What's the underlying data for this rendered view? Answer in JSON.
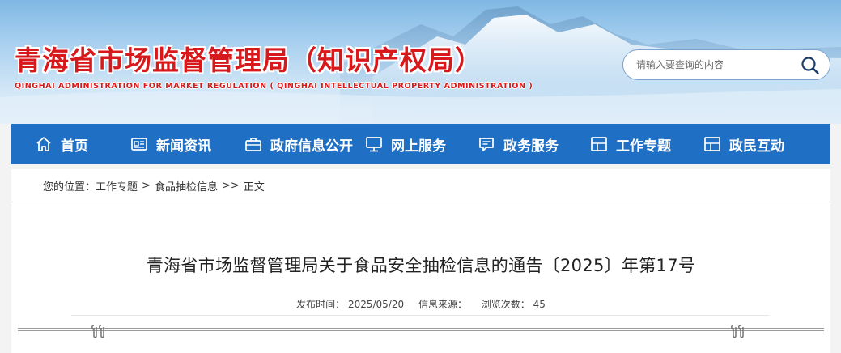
{
  "header": {
    "title": "青海省市场监督管理局（知识产权局）",
    "subtitle": "QINGHAI ADMINISTRATION FOR MARKET REGULATION ( QINGHAI INTELLECTUAL PROPERTY ADMINISTRATION )"
  },
  "search": {
    "placeholder": "请输入要查询的内容",
    "icon": "search-icon"
  },
  "nav": {
    "items": [
      {
        "label": "首页",
        "icon": "home-icon"
      },
      {
        "label": "新闻资讯",
        "icon": "news-icon"
      },
      {
        "label": "政府信息公开",
        "icon": "briefcase-icon"
      },
      {
        "label": "网上服务",
        "icon": "monitor-icon"
      },
      {
        "label": "政务服务",
        "icon": "chat-icon"
      },
      {
        "label": "工作专题",
        "icon": "layout-icon"
      },
      {
        "label": "政民互动",
        "icon": "layout-icon"
      }
    ]
  },
  "breadcrumb": {
    "prefix": "您的位置：",
    "items": [
      "工作专题",
      "食品抽检信息",
      "正文"
    ],
    "sep1": ">",
    "sep2": ">>"
  },
  "article": {
    "title": "青海省市场监督管理局关于食品安全抽检信息的通告〔2025〕年第17号",
    "publish_label": "发布时间：",
    "publish_value": "2025/05/20",
    "source_label": "信息来源：",
    "source_value": "",
    "views_label": "浏览次数：",
    "views_value": "45"
  },
  "colors": {
    "brand_red": "#d8191c",
    "nav_blue": "#1f6fc5"
  }
}
